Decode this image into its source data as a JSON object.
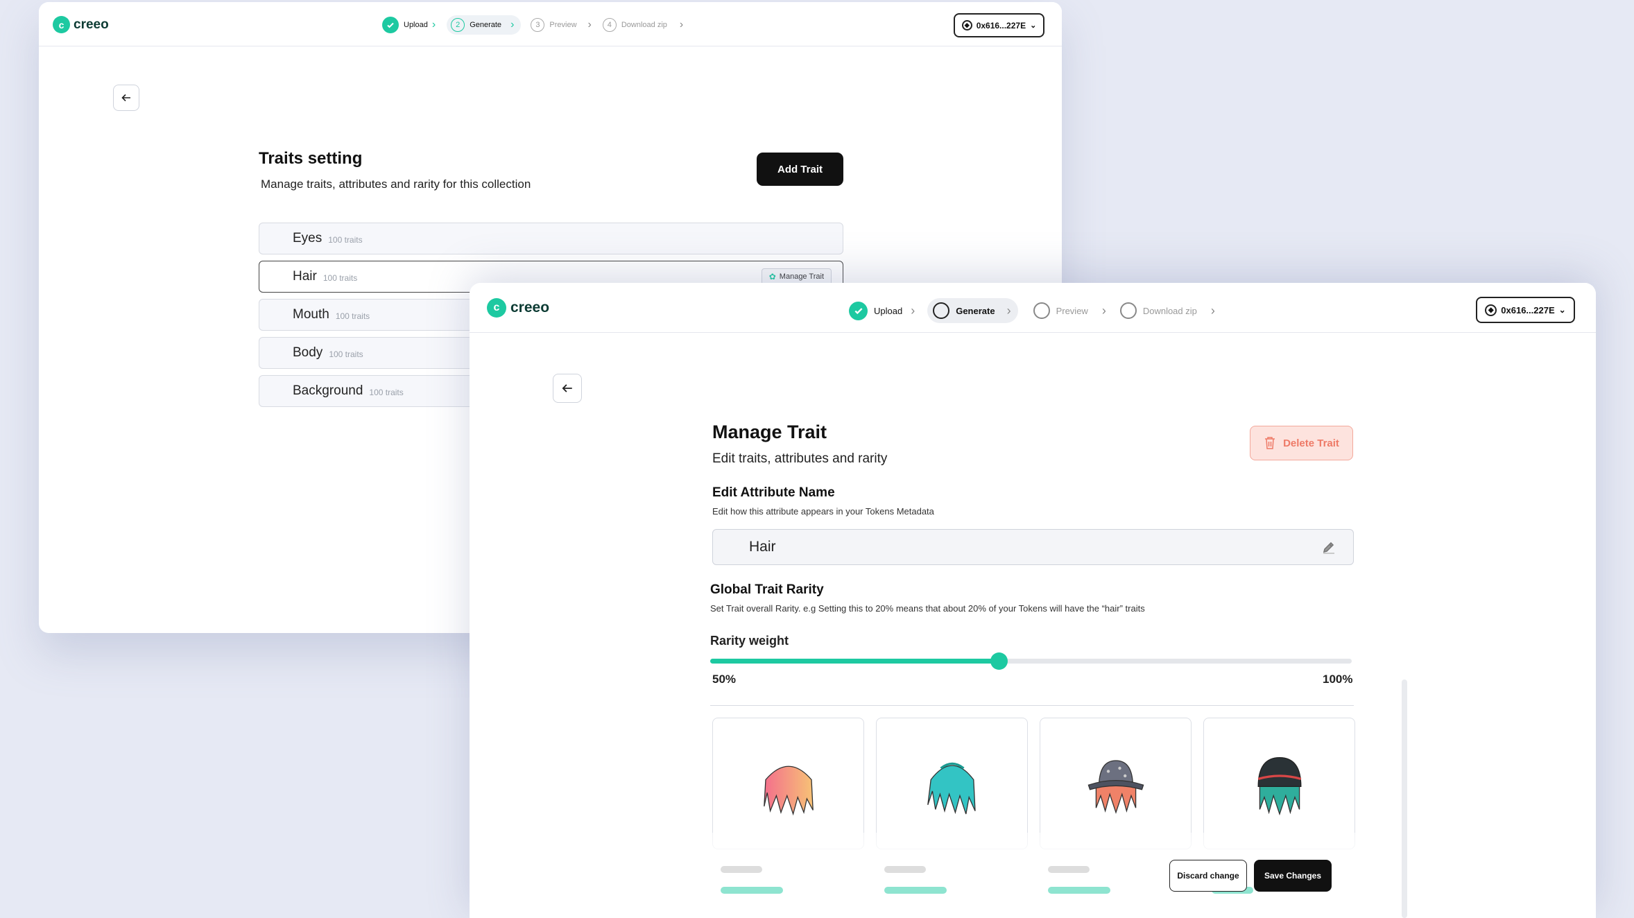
{
  "back_window": {
    "brand": "creeo",
    "steps": [
      {
        "label": "Upload",
        "marker": "check",
        "state": "done"
      },
      {
        "label": "Generate",
        "marker": "2",
        "state": "active"
      },
      {
        "label": "Preview",
        "marker": "3",
        "state": "pending"
      },
      {
        "label": "Download zip",
        "marker": "4",
        "state": "pending"
      }
    ],
    "wallet": "0x616...227E",
    "title": "Traits setting",
    "subtitle": "Manage traits, attributes and rarity for this collection",
    "add_button": "Add Trait",
    "traits": [
      {
        "name": "Eyes",
        "count": "100 traits"
      },
      {
        "name": "Hair",
        "count": "100 traits"
      },
      {
        "name": "Mouth",
        "count": "100 traits"
      },
      {
        "name": "Body",
        "count": "100 traits"
      },
      {
        "name": "Background",
        "count": "100 traits"
      }
    ],
    "manage_chip": "Manage Trait"
  },
  "front_window": {
    "brand": "creeo",
    "steps": [
      {
        "label": "Upload",
        "state": "done"
      },
      {
        "label": "Generate",
        "state": "active"
      },
      {
        "label": "Preview",
        "state": "pending"
      },
      {
        "label": "Download zip",
        "state": "pending"
      }
    ],
    "wallet": "0x616...227E",
    "title": "Manage Trait",
    "subtitle": "Edit traits, attributes and rarity",
    "delete_button": "Delete Trait",
    "attribute": {
      "title": "Edit Attribute Name",
      "description": "Edit how this attribute appears in your Tokens Metadata",
      "value": "Hair"
    },
    "rarity": {
      "title": "Global Trait Rarity",
      "description": "Set Trait overall Rarity.    e.g Setting this to 20% means that about 20% of your Tokens will have the “hair” traits",
      "weight_label": "Rarity weight",
      "value_fraction": 0.45,
      "min_label": "50%",
      "max_label": "100%"
    },
    "trait_cards": [
      {
        "icon": "hair-dreads-pink-icon",
        "colors": [
          "#f58a86",
          "#f6c27a"
        ]
      },
      {
        "icon": "hair-dreads-teal-icon",
        "colors": [
          "#30c9c6",
          "#1aa89e"
        ]
      },
      {
        "icon": "hair-bucket-hat-icon",
        "colors": [
          "#f0826a",
          "#5a5f6e"
        ]
      },
      {
        "icon": "hair-beanie-icon",
        "colors": [
          "#2fae9c",
          "#2a3236"
        ]
      }
    ],
    "discard_button": "Discard change",
    "save_button": "Save Changes"
  },
  "accent_color": "#1dc9a1"
}
